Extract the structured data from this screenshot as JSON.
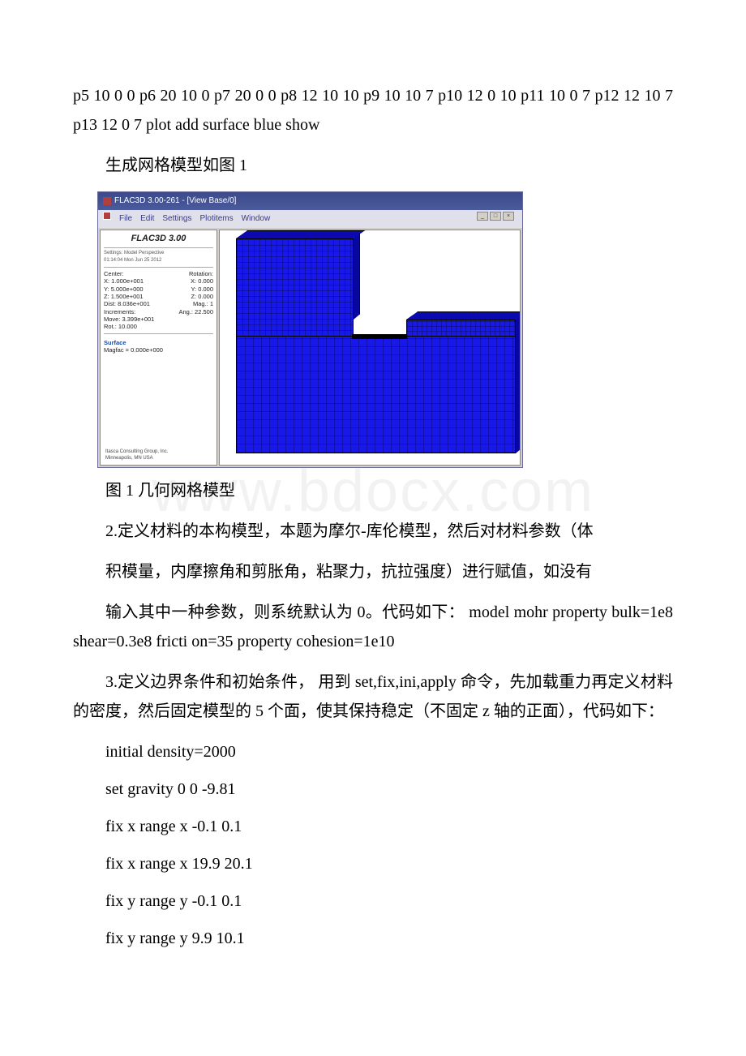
{
  "watermark": "www.bdocx.com",
  "para1": "p5 10 0 0 p6 20 10 0 p7 20 0 0 p8 12 10 10 p9 10 10 7 p10 12 0 10 p11 10 0 7 p12 12 10 7 p13 12 0 7 plot add surface blue show",
  "para2": "生成网格模型如图 1",
  "flac": {
    "title": "FLAC3D 3.00-261 - [View Base/0]",
    "menu": [
      "File",
      "Edit",
      "Settings",
      "Plotitems",
      "Window"
    ],
    "brand": "FLAC3D 3.00",
    "sub1": "Settings: Model Perspective",
    "sub2": "01:14:04 Mon Jun 25 2012",
    "center_label": "Center:",
    "rotation_label": "Rotation:",
    "c1": "X: 1.000e+001",
    "r1v": "X: 0.000",
    "c2": "Y: 5.000e+000",
    "r2v": "Y: 0.000",
    "c3": "Z: 1.500e+001",
    "r3v": "Z: 0.000",
    "dist": "Dist: 8.036e+001",
    "mag": "Mag.: 1",
    "increments": "Increments:",
    "ang": "Ang.: 22.500",
    "move": "Move: 3.399e+001",
    "rot": "Rot.: 10.000",
    "surface_label": "Surface",
    "magfac": "Magfac = 0.000e+000",
    "footer1": "Itasca Consulting Group, Inc.",
    "footer2": "Minneapolis, MN USA"
  },
  "figcaption": "图 1 几何网格模型",
  "para3": "2.定义材料的本构模型，本题为摩尔-库伦模型，然后对材料参数（体",
  "para4": "积模量，内摩擦角和剪胀角，粘聚力，抗拉强度）进行赋值，如没有",
  "para5": "输入其中一种参数，则系统默认为 0。代码如下： model mohr property bulk=1e8 shear=0.3e8 fricti on=35 property cohesion=1e10",
  "para6": "3.定义边界条件和初始条件，  用到 set,fix,ini,apply 命令，先加载重力再定义材料的密度，然后固定模型的 5 个面，使其保持稳定（不固定 z 轴的正面），代码如下：",
  "codes": {
    "l1": "initial density=2000",
    "l2": "set gravity 0 0 -9.81",
    "l3": "fix x range x -0.1 0.1",
    "l4": "fix x range x 19.9 20.1",
    "l5": "fix y range y -0.1 0.1",
    "l6": "fix y range y 9.9 10.1"
  }
}
